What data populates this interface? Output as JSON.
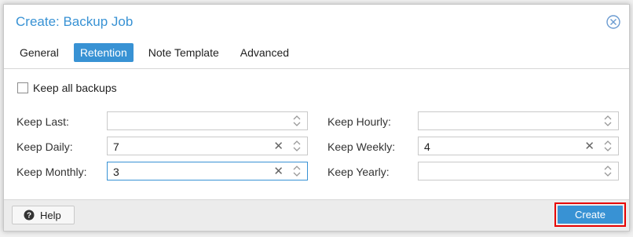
{
  "dialog": {
    "title": "Create: Backup Job"
  },
  "tabs": [
    {
      "label": "General",
      "active": false
    },
    {
      "label": "Retention",
      "active": true
    },
    {
      "label": "Note Template",
      "active": false
    },
    {
      "label": "Advanced",
      "active": false
    }
  ],
  "keep_all": {
    "label": "Keep all backups",
    "checked": false
  },
  "fields": {
    "keep_last": {
      "label": "Keep Last:",
      "value": ""
    },
    "keep_daily": {
      "label": "Keep Daily:",
      "value": "7"
    },
    "keep_monthly": {
      "label": "Keep Monthly:",
      "value": "3"
    },
    "keep_hourly": {
      "label": "Keep Hourly:",
      "value": ""
    },
    "keep_weekly": {
      "label": "Keep Weekly:",
      "value": "4"
    },
    "keep_yearly": {
      "label": "Keep Yearly:",
      "value": ""
    }
  },
  "footer": {
    "help_label": "Help",
    "create_label": "Create"
  },
  "icons": {
    "close": "close-icon",
    "help": "help-icon",
    "clear": "clear-icon",
    "spinner": "spinner-icon"
  },
  "colors": {
    "accent": "#3892d4",
    "highlight": "#e60000"
  }
}
